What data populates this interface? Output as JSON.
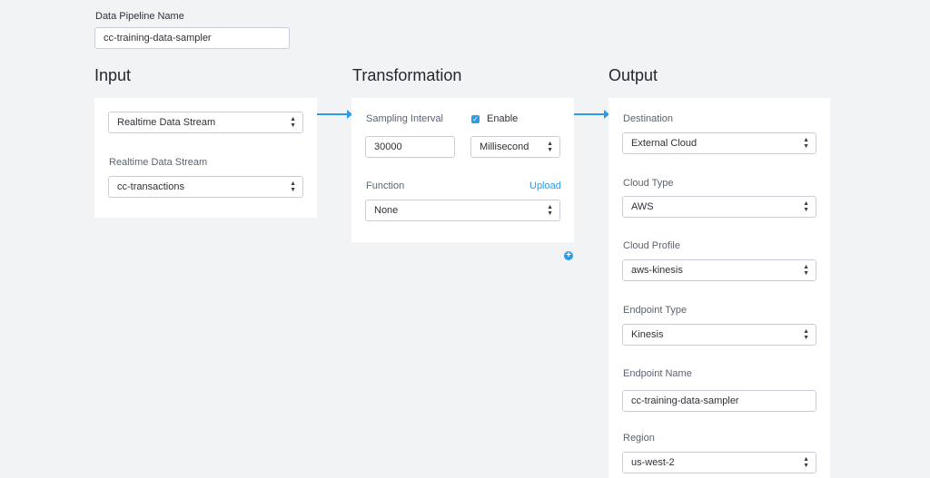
{
  "pipeline": {
    "name_label": "Data Pipeline Name",
    "name_value": "cc-training-data-sampler"
  },
  "input": {
    "title": "Input",
    "source_type": "Realtime Data Stream",
    "stream_label": "Realtime Data Stream",
    "stream_value": "cc-transactions"
  },
  "transformation": {
    "title": "Transformation",
    "sampling_label": "Sampling Interval",
    "enable_label": "Enable",
    "enable_checked": true,
    "sampling_value": "30000",
    "unit_value": "Millisecond",
    "function_label": "Function",
    "upload_label": "Upload",
    "function_value": "None"
  },
  "output": {
    "title": "Output",
    "destination_label": "Destination",
    "destination_value": "External Cloud",
    "cloud_type_label": "Cloud Type",
    "cloud_type_value": "AWS",
    "cloud_profile_label": "Cloud Profile",
    "cloud_profile_value": "aws-kinesis",
    "endpoint_type_label": "Endpoint Type",
    "endpoint_type_value": "Kinesis",
    "endpoint_name_label": "Endpoint Name",
    "endpoint_name_value": "cc-training-data-sampler",
    "region_label": "Region",
    "region_value": "us-west-2"
  },
  "colors": {
    "accent": "#2d9be6",
    "background": "#f2f3f5",
    "card": "#ffffff"
  }
}
